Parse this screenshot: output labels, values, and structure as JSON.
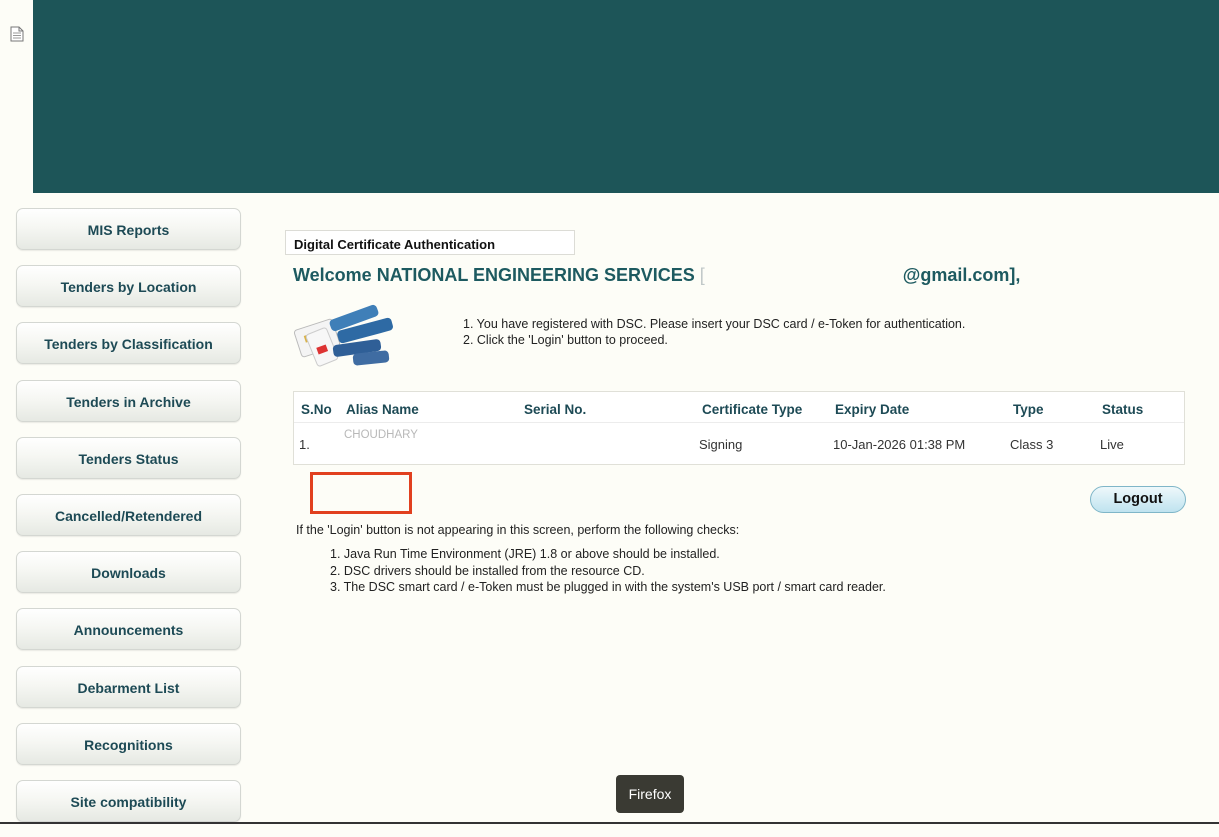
{
  "sidebar": {
    "items": [
      {
        "label": "MIS Reports"
      },
      {
        "label": "Tenders by Location"
      },
      {
        "label": "Tenders by Classification"
      },
      {
        "label": "Tenders in Archive"
      },
      {
        "label": "Tenders Status"
      },
      {
        "label": "Cancelled/Retendered"
      },
      {
        "label": "Downloads"
      },
      {
        "label": "Announcements"
      },
      {
        "label": "Debarment List"
      },
      {
        "label": "Recognitions"
      },
      {
        "label": "Site compatibility"
      }
    ]
  },
  "main": {
    "section_title": "Digital Certificate Authentication",
    "welcome_prefix": "Welcome NATIONAL ENGINEERING SERVICES",
    "welcome_open": "[",
    "welcome_suffix": "@gmail.com],",
    "instructions": [
      "1. You have registered with DSC. Please insert your DSC card / e-Token for authentication.",
      "2. Click the 'Login' button to proceed."
    ],
    "table": {
      "headers": [
        "S.No",
        "Alias Name",
        "Serial No.",
        "Certificate Type",
        "Expiry Date",
        "Type",
        "Status"
      ],
      "rows": [
        {
          "sno": "1.",
          "alias": "CHOUDHARY",
          "serial": "",
          "cert_type": "Signing",
          "expiry": "10-Jan-2026 01:38 PM",
          "type": "Class 3",
          "status": "Live"
        }
      ]
    },
    "logout_label": "Logout",
    "checks_intro": "If the 'Login' button is not appearing in this screen, perform the following checks:",
    "checks": [
      "1. Java Run Time Environment (JRE) 1.8 or above should be installed.",
      "2. DSC drivers should be installed from the resource CD.",
      "3. The DSC smart card / e-Token must be plugged in with the system's USB port / smart card reader."
    ]
  },
  "toast": {
    "label": "Firefox"
  },
  "colors": {
    "header": "#1d5558",
    "nav_text": "#1d4a55",
    "welcome": "#1d5a60",
    "highlight": "#e1401f"
  }
}
